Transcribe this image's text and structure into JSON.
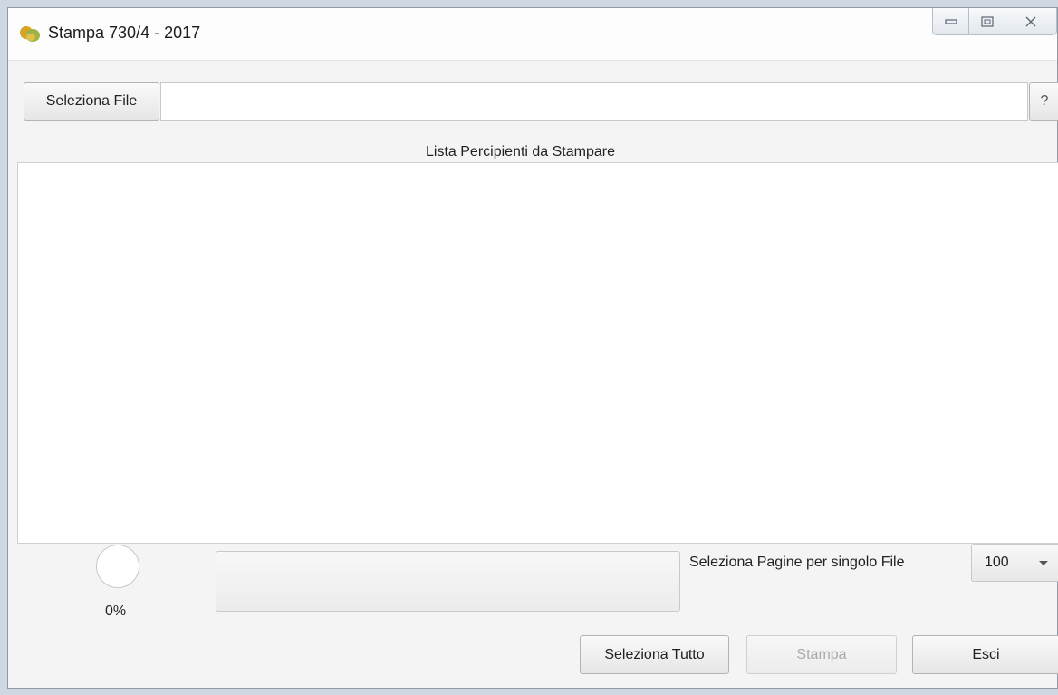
{
  "window": {
    "title": "Stampa 730/4 - 2017"
  },
  "toolbar": {
    "select_file_label": "Seleziona File",
    "file_path_value": "",
    "help_label": "?"
  },
  "list": {
    "heading": "Lista Percipienti da Stampare",
    "items": []
  },
  "progress": {
    "percent_text": "0%",
    "percent": 0
  },
  "pages": {
    "label": "Seleziona Pagine per singolo File",
    "selected": "100"
  },
  "footer": {
    "select_all_label": "Seleziona Tutto",
    "print_label": "Stampa",
    "exit_label": "Esci"
  }
}
